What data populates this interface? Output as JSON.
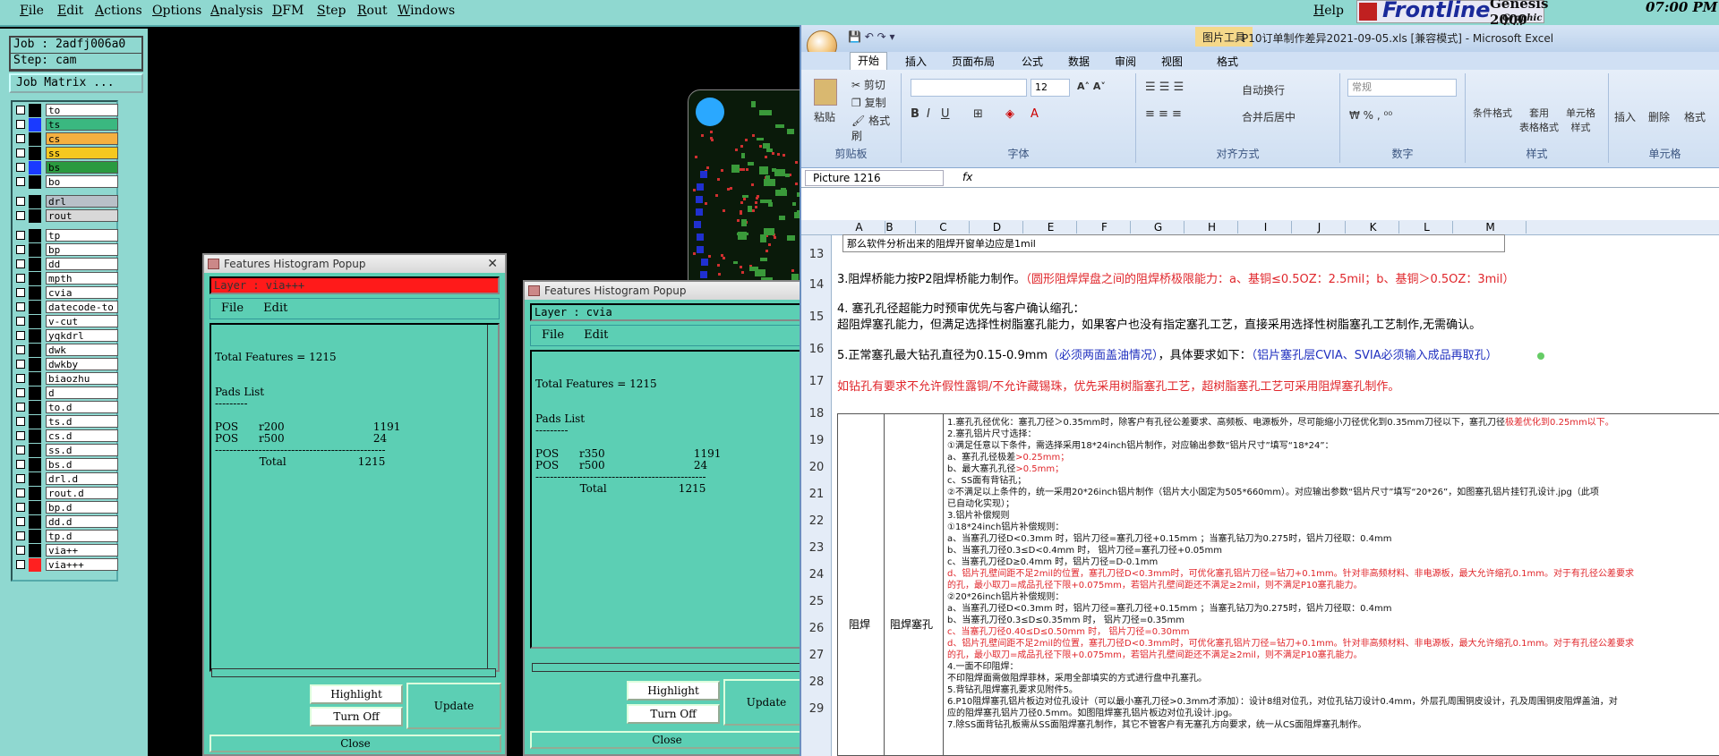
{
  "genesis": {
    "menu": [
      "File",
      "Edit",
      "Actions",
      "Options",
      "Analysis",
      "DFM",
      "Step",
      "Rout",
      "Windows"
    ],
    "help": "Help",
    "brand": "Frontline",
    "product": "Genesis 2000",
    "subtitle": "Graphic Editor",
    "time": "07:00 PM",
    "job": "Job : 2adfj006a0",
    "step": "Step: cam",
    "job_matrix": "Job Matrix ...",
    "layers": [
      {
        "name": "to",
        "color": "#000000",
        "hl": "#ffffff"
      },
      {
        "name": "ts",
        "color": "#1a3aff",
        "hl": "#3ab880"
      },
      {
        "name": "cs",
        "color": "#000000",
        "hl": "#f5b040"
      },
      {
        "name": "ss",
        "color": "#000000",
        "hl": "#f5c820"
      },
      {
        "name": "bs",
        "color": "#1a3aff",
        "hl": "#2a9a40"
      },
      {
        "name": "bo",
        "color": "#000000",
        "hl": "#ffffff"
      },
      {
        "name": "drl",
        "color": "#000000",
        "hl": "#b8c0c8"
      },
      {
        "name": "rout",
        "color": "#000000",
        "hl": "#d8d8d8"
      },
      {
        "name": "tp",
        "color": "#000000",
        "hl": "#ffffff"
      },
      {
        "name": "bp",
        "color": "#000000",
        "hl": "#ffffff"
      },
      {
        "name": "dd",
        "color": "#000000",
        "hl": "#ffffff"
      },
      {
        "name": "mpth",
        "color": "#000000",
        "hl": "#ffffff"
      },
      {
        "name": "cvia",
        "color": "#000000",
        "hl": "#ffffff"
      },
      {
        "name": "datecode-to",
        "color": "#000000",
        "hl": "#ffffff"
      },
      {
        "name": "v-cut",
        "color": "#000000",
        "hl": "#ffffff"
      },
      {
        "name": "yqkdrl",
        "color": "#000000",
        "hl": "#ffffff"
      },
      {
        "name": "dwk",
        "color": "#000000",
        "hl": "#ffffff"
      },
      {
        "name": "dwkby",
        "color": "#000000",
        "hl": "#ffffff"
      },
      {
        "name": "biaozhu",
        "color": "#000000",
        "hl": "#ffffff"
      },
      {
        "name": "d",
        "color": "#000000",
        "hl": "#ffffff"
      },
      {
        "name": "to.d",
        "color": "#000000",
        "hl": "#ffffff"
      },
      {
        "name": "ts.d",
        "color": "#000000",
        "hl": "#ffffff"
      },
      {
        "name": "cs.d",
        "color": "#000000",
        "hl": "#ffffff"
      },
      {
        "name": "ss.d",
        "color": "#000000",
        "hl": "#ffffff"
      },
      {
        "name": "bs.d",
        "color": "#000000",
        "hl": "#ffffff"
      },
      {
        "name": "drl.d",
        "color": "#000000",
        "hl": "#ffffff"
      },
      {
        "name": "rout.d",
        "color": "#000000",
        "hl": "#ffffff"
      },
      {
        "name": "bp.d",
        "color": "#000000",
        "hl": "#ffffff"
      },
      {
        "name": "dd.d",
        "color": "#000000",
        "hl": "#ffffff"
      },
      {
        "name": "tp.d",
        "color": "#000000",
        "hl": "#ffffff"
      },
      {
        "name": "via++",
        "color": "#000000",
        "hl": "#ffffff"
      },
      {
        "name": "via+++",
        "color": "#ff2020",
        "hl": "#ffffff"
      }
    ]
  },
  "popup1": {
    "title": "Features Histogram Popup",
    "layer": "Layer :  via+++",
    "file": "File",
    "edit": "Edit",
    "text": "Total Features = 1215\n\n\nPads List\n---------\n\nPOS      r200                          1191\nPOS      r500                          24\n-----------------------------------------------\n             Total                     1215",
    "highlight": "Highlight",
    "turnoff": "Turn Off",
    "update": "Update",
    "close": "Close"
  },
  "popup2": {
    "title": "Features Histogram Popup",
    "layer": "Layer :  cvia",
    "file": "File",
    "edit": "Edit",
    "text": "Total Features = 1215\n\n\nPads List\n---------\n\nPOS      r350                          1191\nPOS      r500                          24\n-----------------------------------------------\n             Total                     1215",
    "highlight": "Highlight",
    "turnoff": "Turn Off",
    "update": "Update",
    "close": "Close"
  },
  "excel": {
    "context_tab": "图片工具",
    "title": "P10订单制作差异2021-09-05.xls  [兼容模式] - Microsoft Excel",
    "tabs": [
      "开始",
      "插入",
      "页面布局",
      "公式",
      "数据",
      "审阅",
      "视图",
      "格式"
    ],
    "groups": [
      "剪贴板",
      "字体",
      "对齐方式",
      "数字",
      "样式",
      "单元格"
    ],
    "clipboard": {
      "paste": "粘贴",
      "cut": "剪切",
      "copy": "复制",
      "painter": "格式刷"
    },
    "font_size": "12",
    "wrap": "自动换行",
    "merge": "合并后居中",
    "number_format": "常规",
    "styles": [
      "条件格式",
      "套用\n表格格式",
      "单元格\n样式"
    ],
    "cells": [
      "插入",
      "删除",
      "格式"
    ],
    "namebox": "Picture 1216",
    "fx": "fx",
    "columns": [
      "A",
      "B",
      "C",
      "D",
      "E",
      "F",
      "G",
      "H",
      "I",
      "J",
      "K",
      "L",
      "M"
    ],
    "rows": [
      "13",
      "14",
      "15",
      "16",
      "17",
      "18",
      "19",
      "20",
      "21",
      "22",
      "23",
      "24",
      "25",
      "26",
      "27",
      "28",
      "29"
    ],
    "r12_note": "那么软件分析出来的阻焊开窗单边应是1mil",
    "r14a": "3.阻焊桥能力按P2阻焊桥能力制作。",
    "r14b": "（圆形阻焊焊盘之间的阻焊桥极限能力：a、基铜≤0.5OZ：2.5mil；b、基铜＞0.5OZ：3mil）",
    "r15a": "4. 塞孔孔径超能力时预审优先与客户确认缩孔：",
    "r15b": "超阻焊塞孔能力，但满足选择性树脂塞孔能力，如果客户也没有指定塞孔工艺，直接采用选择性树脂塞孔工艺制作,无需确认。",
    "r16a": "5.正常塞孔最大钻孔直径为0.15-0.9mm",
    "r16b": "（必须两面盖油情况）",
    "r16c": "，具体要求如下：",
    "r16d": "（铝片塞孔层CVIA、SVIA必须输入成品再取孔）",
    "r17": "如钻孔有要求不允许假性露铜/不允许藏锡珠，优先采用树脂塞孔工艺，超树脂塞孔工艺可采用阻焊塞孔制作。",
    "cell_a": "阻焊",
    "cell_b": "阻焊塞孔",
    "detail": [
      {
        "t": "1.塞孔孔径优化：塞孔刀径＞0.35mm时，除客户有孔径公差要求、高频板、电源板外，尽可能缩小刀径优化到0.35mm刀径以下，塞孔刀径",
        "r": "极差优化到0.25mm以下。"
      },
      {
        "t": "2.塞孔铝片尺寸选择：",
        "r": ""
      },
      {
        "t": "①满足任意以下条件，需选择采用18*24inch铝片制作，对应输出参数“铝片尺寸”填写“18*24”：",
        "r": ""
      },
      {
        "t": "a、塞孔孔径极差",
        "r": ">0.25mm；"
      },
      {
        "t": "b、最大塞孔孔径",
        "r": ">0.5mm；"
      },
      {
        "t": "c、SS面有背钻孔；",
        "r": ""
      },
      {
        "t": "②不满足以上条件的，统一采用20*26inch铝片制作（铝片大小固定为505*660mm）。对应输出参数“铝片尺寸”填写“20*26”，如图塞孔铝片挂钉孔设计.jpg（此项",
        "r": ""
      },
      {
        "t": "已自动化实现）；",
        "r": ""
      },
      {
        "t": "3.铝片补偿规则",
        "r": ""
      },
      {
        "t": "①18*24inch铝片补偿规则：",
        "r": ""
      },
      {
        "t": "a、当塞孔刀径D<0.3mm 时，铝片刀径=塞孔刀径+0.15mm ；当塞孔钻刀为0.275时，铝片刀径取：0.4mm",
        "r": ""
      },
      {
        "t": "b、当塞孔刀径0.3≤D<0.4mm 时， 铝片刀径=塞孔刀径+0.05mm",
        "r": ""
      },
      {
        "t": "c、当塞孔刀径D≥0.4mm 时，铝片刀径=D-0.1mm",
        "r": ""
      },
      {
        "t": "",
        "r": "d、铝片孔壁间距不足2mil的位置，塞孔刀径D<0.3mm时，可优化塞孔铝片刀径=钻刀+0.1mm。针对非高频材料、非电源板，最大允许缩孔0.1mm。对于有孔径公差要求"
      },
      {
        "t": "",
        "r": "的孔，最小取刀=成品孔径下限+0.075mm，若铝片孔壁间距还不满足≥2mil，则不满足P10塞孔能力。"
      },
      {
        "t": "②20*26inch铝片补偿规则：",
        "r": ""
      },
      {
        "t": "a、当塞孔刀径D<0.3mm 时，铝片刀径=塞孔刀径+0.15mm ；当塞孔钻刀为0.275时，铝片刀径取：0.4mm",
        "r": ""
      },
      {
        "t": "b、当塞孔刀径0.3≤D≤0.35mm 时， 铝片刀径=0.35mm",
        "r": ""
      },
      {
        "t": "",
        "r": "c、当塞孔刀径0.40≤D≤0.50mm 时， 铝片刀径=0.30mm"
      },
      {
        "t": "",
        "r": "d、铝片孔壁间距不足2mil的位置，塞孔刀径D<0.3mm时，可优化塞孔铝片刀径=钻刀+0.1mm。针对非高频材料、非电源板，最大允许缩孔0.1mm。对于有孔径公差要求"
      },
      {
        "t": "",
        "r": "的孔，最小取刀=成品孔径下限+0.075mm，若铝片孔壁间距还不满足≥2mil，则不满足P10塞孔能力。"
      },
      {
        "t": "4.一面不印阻焊：",
        "r": ""
      },
      {
        "t": "不印阻焊面需做阻焊菲林，采用全部填实的方式进行盘中孔塞孔。",
        "r": ""
      },
      {
        "t": "5.背钻孔阻焊塞孔要求见附件5。",
        "r": ""
      },
      {
        "t": "6.P10阻焊塞孔铝片板边对位孔设计（可以最小塞孔刀径>0.3mm才添加）：设计8组对位孔，对位孔钻刀设计0.4mm，外层孔周围铜皮设计，孔及周围铜皮阻焊盖油，对",
        "r": ""
      },
      {
        "t": "应的阻焊塞孔铝片刀径0.5mm。如图阻焊塞孔铝片板边对位孔设计.jpg。",
        "r": ""
      },
      {
        "t": "7.除SS面背钻孔板需从SS面阻焊塞孔制作，其它不管客户有无塞孔方向要求，统一从CS面阻焊塞孔制作。",
        "r": ""
      }
    ]
  }
}
